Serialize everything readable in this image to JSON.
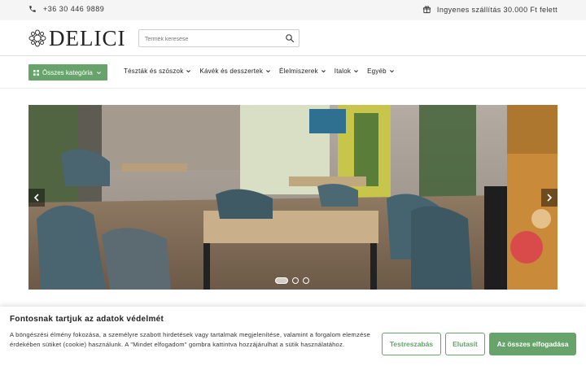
{
  "topbar": {
    "phone": "+36 30 446 9889",
    "shipping": "Ingyenes szállítás 30.000 Ft felett",
    "phone_icon": "phone-icon",
    "shipping_icon": "gift-icon"
  },
  "header": {
    "logo_text": "DELICI",
    "search": {
      "placeholder": "Termék keresése"
    }
  },
  "nav": {
    "all_categories": "Összes kategória",
    "items": [
      {
        "label": "Tészták és szószok"
      },
      {
        "label": "Kávék és desszertek"
      },
      {
        "label": "Élelmiszerek"
      },
      {
        "label": "Italok"
      },
      {
        "label": "Egyéb"
      }
    ]
  },
  "slider": {
    "slide_count": 3,
    "active_index": 0
  },
  "cookie": {
    "title": "Fontosnak tartjuk az adatok védelmét",
    "text": "A böngészési élmény fokozása, a személyre szabott hirdetések vagy tartalmak megjelenítése, valamint a forgalom elemzése érdekében sütiket (cookie) használunk. A \"Mindet elfogadom\" gombra kattintva hozzájárulhat a sütik használatához.",
    "btn_customize": "Testreszabás",
    "btn_reject": "Elutasít",
    "btn_accept_all": "Az összes elfogadása"
  },
  "colors": {
    "accent": "#67a36a",
    "topbar_bg": "#f5f5f5"
  }
}
